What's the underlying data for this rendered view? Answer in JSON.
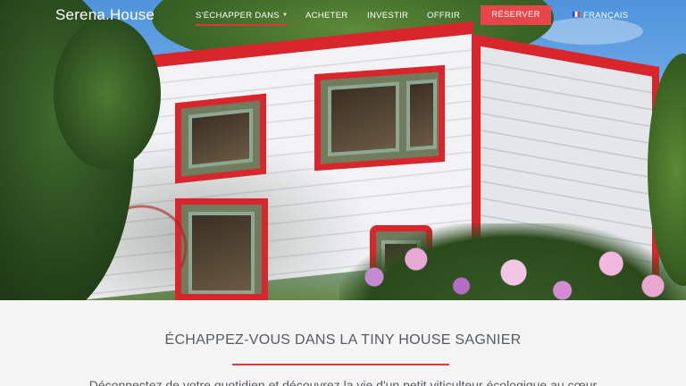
{
  "brand": "Serena.House",
  "nav": {
    "items": [
      {
        "label": "S'ÉCHAPPER DANS",
        "has_dropdown": true,
        "active": true
      },
      {
        "label": "ACHETER"
      },
      {
        "label": "INVESTIR"
      },
      {
        "label": "OFFRIR"
      }
    ],
    "reserve_label": "RÉSERVER",
    "language": "FRANÇAIS"
  },
  "content": {
    "headline": "ÉCHAPPEZ-VOUS DANS LA TINY HOUSE SAGNIER",
    "intro": "Déconnectez de votre quotidien et découvrez la vie d'un petit viticulteur écologique au cœur"
  },
  "colors": {
    "accent": "#e0353b",
    "button": "#e8454b",
    "text": "#555a60",
    "background": "#f5f5f5"
  },
  "icons": {
    "dropdown": "chevron-down-icon",
    "language_flag": "flag-france-icon"
  }
}
